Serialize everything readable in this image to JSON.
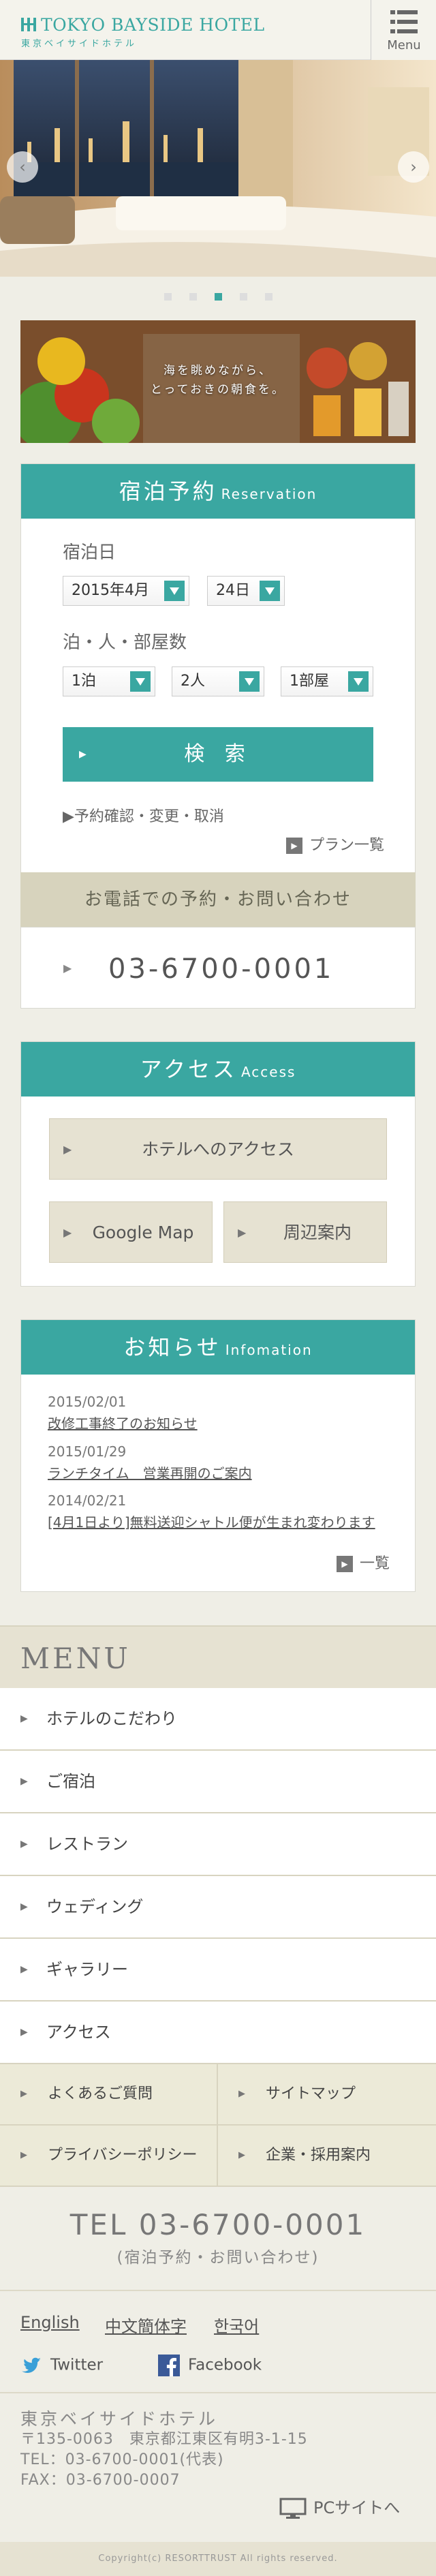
{
  "header": {
    "logo_en": "TOKYO BAYSIDE HOTEL",
    "logo_jp": "東京ベイサイドホテル",
    "menu_label": "Menu",
    "accent_color": "#3aa7a1"
  },
  "hero": {
    "prev_icon": "chevron-left-icon",
    "next_icon": "chevron-right-icon",
    "slide_count": 5,
    "active_slide": 3
  },
  "banner": {
    "line1": "海を眺めながら、",
    "line2": "とっておきの朝食を。"
  },
  "reservation": {
    "title": "宿泊予約",
    "title_en": "Reservation",
    "date_label": "宿泊日",
    "month_value": "2015年4月",
    "day_value": "24日",
    "guests_label": "泊・人・部屋数",
    "nights_value": "1泊",
    "people_value": "2人",
    "rooms_value": "1部屋",
    "search_label": "検 索",
    "manage_link": "▶予約確認・変更・取消",
    "plans_link": "プラン一覧"
  },
  "phone": {
    "title": "お電話での予約・お問い合わせ",
    "number": "03-6700-0001"
  },
  "access": {
    "title": "アクセス",
    "title_en": "Access",
    "hotel_access": "ホテルへのアクセス",
    "google_map": "Google Map",
    "area_guide": "周辺案内"
  },
  "news": {
    "title": "お知らせ",
    "title_en": "Infomation",
    "items": [
      {
        "date": "2015/02/01",
        "title": "改修工事終了のお知らせ"
      },
      {
        "date": "2015/01/29",
        "title": "ランチタイム　営業再開のご案内"
      },
      {
        "date": "2014/02/21",
        "title": "[4月1日より]無料送迎シャトル便が生まれ変わります"
      }
    ],
    "list_link": "一覧"
  },
  "menu": {
    "title": "MENU",
    "items": [
      "ホテルのこだわり",
      "ご宿泊",
      "レストラン",
      "ウェディング",
      "ギャラリー",
      "アクセス"
    ],
    "sub_items": [
      "よくあるご質問",
      "サイトマップ",
      "プライバシーポリシー",
      "企業・採用案内"
    ]
  },
  "footer": {
    "tel": "TEL 03-6700-0001",
    "tel_sub": "(宿泊予約・お問い合わせ)",
    "languages": [
      "English",
      "中文簡体字",
      "한국어"
    ],
    "twitter": "Twitter",
    "facebook": "Facebook",
    "address_name": "東京ベイサイドホテル",
    "address": "〒135-0063　東京都江東区有明3-1-15",
    "tel_line": "TEL：03-6700-0001(代表)",
    "fax_line": "FAX：03-6700-0007",
    "pc_site": "PCサイトへ",
    "copyright": "Copyright(c) RESORTTRUST All rights reserved."
  }
}
